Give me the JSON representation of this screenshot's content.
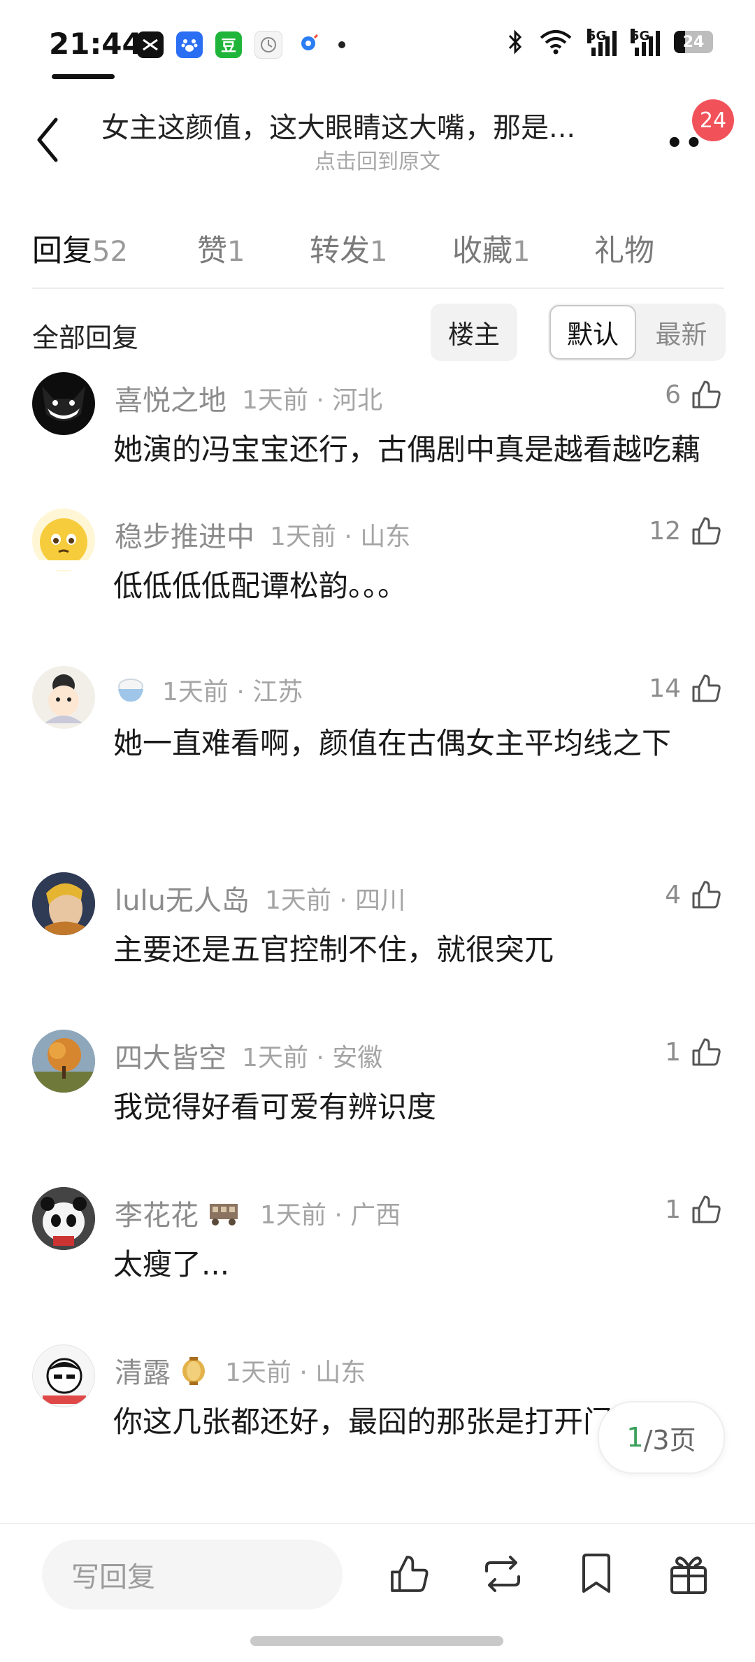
{
  "status_bar": {
    "time": "21:44",
    "apps": [
      "capcut-icon",
      "baidu-icon",
      "douban-icon",
      "clock-icon",
      "maps-icon"
    ],
    "douban_glyph": "豆",
    "network_label_1": "5G",
    "network_label_2": "5G",
    "battery": "24"
  },
  "header": {
    "title": "女主这颜值，这大眼睛这大嘴，那是...",
    "subtitle": "点击回到原文",
    "more": "••",
    "badge": "24"
  },
  "tabs": [
    {
      "label": "回复",
      "count": "52"
    },
    {
      "label": "赞",
      "count": "1"
    },
    {
      "label": "转发",
      "count": "1"
    },
    {
      "label": "收藏",
      "count": "1"
    },
    {
      "label": "礼物",
      "count": ""
    }
  ],
  "filter": {
    "title": "全部回复",
    "owner_chip": "楼主",
    "sort_options": [
      "默认",
      "最新"
    ],
    "selected": "默认"
  },
  "comments": [
    {
      "name": "喜悦之地",
      "meta": "1天前 · 河北",
      "likes": "6",
      "text": "她演的冯宝宝还行，古偶剧中真是越看越吃藕"
    },
    {
      "name": "稳步推进中",
      "meta": "1天前 · 山东",
      "likes": "12",
      "text": "低低低低配谭松韵。。。"
    },
    {
      "name": "",
      "meta": "1天前 · 江苏",
      "likes": "14",
      "text": "她一直难看啊，颜值在古偶女主平均线之下"
    },
    {
      "name": "lulu无人岛",
      "meta": "1天前 · 四川",
      "likes": "4",
      "text": "主要还是五官控制不住，就很突兀"
    },
    {
      "name": "四大皆空",
      "meta": "1天前 · 安徽",
      "likes": "1",
      "text": "我觉得好看可爱有辨识度"
    },
    {
      "name": "李花花",
      "meta": "1天前 · 广西",
      "likes": "1",
      "text": "太瘦了..."
    },
    {
      "name": "清露",
      "meta": "1天前 · 山东",
      "likes": "",
      "text": "你这几张都还好，最囧的那张是打开门往"
    }
  ],
  "pagination": {
    "current": "1",
    "total": "/3页"
  },
  "bottom_bar": {
    "reply_placeholder": "写回复",
    "icons": [
      "like-icon",
      "repost-icon",
      "bookmark-icon",
      "gift-icon"
    ]
  },
  "colors": {
    "badge": "#f1525a",
    "accent_green": "#3aa05a",
    "muted_text": "#8c8c8c"
  }
}
